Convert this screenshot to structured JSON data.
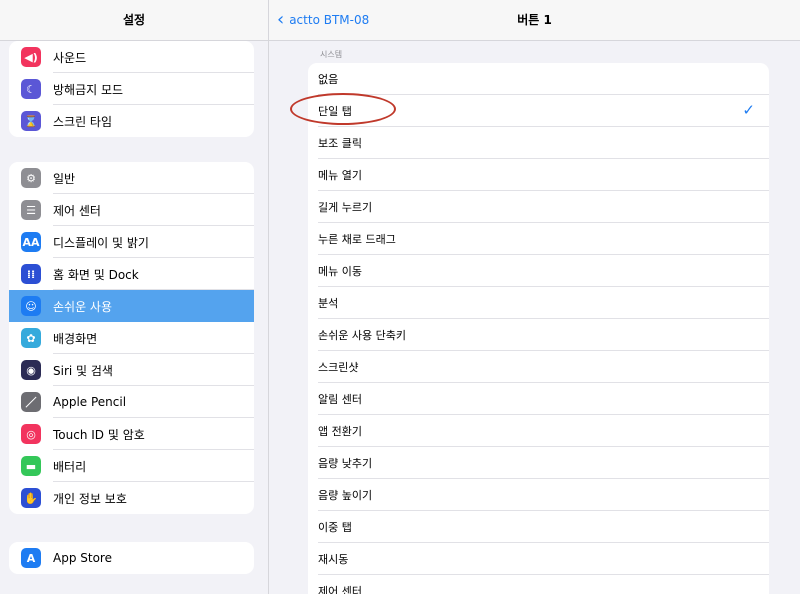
{
  "sidebar": {
    "title": "설정",
    "group1": [
      {
        "label": "사운드",
        "icon": "speaker-icon",
        "color": "#f2345e",
        "glyph": "◀)"
      },
      {
        "label": "방해금지 모드",
        "icon": "moon-icon",
        "color": "#5b57d6",
        "glyph": "☾"
      },
      {
        "label": "스크린 타임",
        "icon": "hourglass-icon",
        "color": "#5b57d6",
        "glyph": "⌛"
      }
    ],
    "group2": [
      {
        "label": "일반",
        "icon": "gear-icon",
        "color": "#8e8e93",
        "glyph": "⚙"
      },
      {
        "label": "제어 센터",
        "icon": "toggles-icon",
        "color": "#8e8e93",
        "glyph": "☰"
      },
      {
        "label": "디스플레이 및 밝기",
        "icon": "text-size-icon",
        "color": "#1e7cf2",
        "glyph": "AA"
      },
      {
        "label": "홈 화면 및 Dock",
        "icon": "grid-icon",
        "color": "#2c4fd4",
        "glyph": "⁞⁞"
      },
      {
        "label": "손쉬운 사용",
        "icon": "accessibility-icon",
        "color": "#1e7cf2",
        "glyph": "☺",
        "selected": true
      },
      {
        "label": "배경화면",
        "icon": "flower-icon",
        "color": "#35aadc",
        "glyph": "✿"
      },
      {
        "label": "Siri 및 검색",
        "icon": "siri-icon",
        "color": "#2b2b55",
        "glyph": "◉"
      },
      {
        "label": "Apple Pencil",
        "icon": "pencil-icon",
        "color": "#6d6d72",
        "glyph": "／"
      },
      {
        "label": "Touch ID 및 암호",
        "icon": "fingerprint-icon",
        "color": "#f2345e",
        "glyph": "◎"
      },
      {
        "label": "배터리",
        "icon": "battery-icon",
        "color": "#34c759",
        "glyph": "▬"
      },
      {
        "label": "개인 정보 보호",
        "icon": "hand-icon",
        "color": "#2c4fd4",
        "glyph": "✋"
      }
    ],
    "group3": [
      {
        "label": "App Store",
        "icon": "app-store-icon",
        "color": "#1e7cf2",
        "glyph": "A"
      }
    ]
  },
  "detail": {
    "back_label": "actto BTM-08",
    "title": "버튼 1",
    "section_header": "시스템",
    "checkmark": "✓",
    "options": [
      {
        "label": "없음"
      },
      {
        "label": "단일 탭",
        "checked": true
      },
      {
        "label": "보조 클릭"
      },
      {
        "label": "메뉴 열기"
      },
      {
        "label": "길게 누르기"
      },
      {
        "label": "누른 채로 드래그"
      },
      {
        "label": "메뉴 이동"
      },
      {
        "label": "분석"
      },
      {
        "label": "손쉬운 사용 단축키"
      },
      {
        "label": "스크린샷"
      },
      {
        "label": "알림 센터"
      },
      {
        "label": "앱 전환기"
      },
      {
        "label": "음량 낮추기"
      },
      {
        "label": "음량 높이기"
      },
      {
        "label": "이중 탭"
      },
      {
        "label": "재시동"
      },
      {
        "label": "제어 센터"
      }
    ]
  },
  "colors": {
    "accent": "#1e7cf2",
    "selection": "#54a3ee",
    "annotation": "#c0392b",
    "background": "#f2f2f7"
  }
}
